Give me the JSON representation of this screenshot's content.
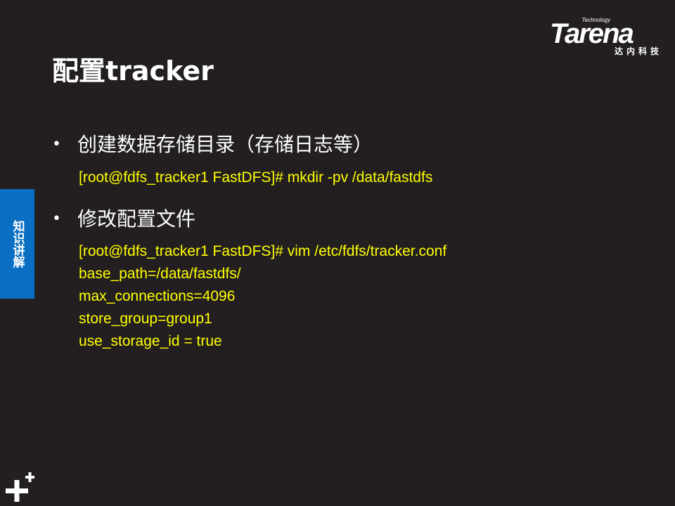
{
  "slide": {
    "title": "配置tracker",
    "logo": {
      "tagline": "Technology",
      "wordmark": "Tarena",
      "chinese": "达内科技"
    },
    "side_tab": {
      "label": "知识讲解",
      "color": "#0a6fc2"
    },
    "bullets": [
      {
        "text": "创建数据存储目录（存储日志等）",
        "code": [
          "[root@fdfs_tracker1 FastDFS]# mkdir -pv /data/fastdfs"
        ]
      },
      {
        "text": "修改配置文件",
        "code": [
          "[root@fdfs_tracker1 FastDFS]# vim /etc/fdfs/tracker.conf",
          "base_path=/data/fastdfs/",
          "max_connections=4096",
          "store_group=group1",
          "use_storage_id = true"
        ]
      }
    ],
    "colors": {
      "background": "#231f20",
      "code_text": "#ffff00",
      "text": "#ffffff"
    },
    "corner_icon": "plus-plus-icon"
  }
}
